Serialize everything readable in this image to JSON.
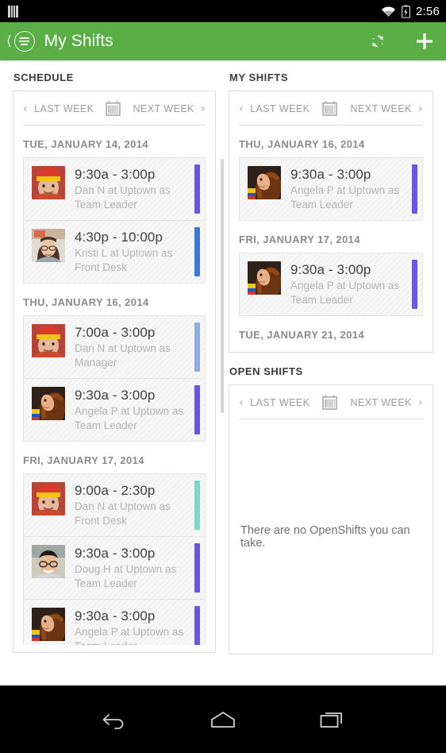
{
  "statusbar": {
    "clock": "2:56",
    "icons": [
      "sim-card-icon",
      "wifi-icon",
      "battery-icon"
    ]
  },
  "appbar": {
    "title": "My Shifts",
    "up_icon": "back-chevron-icon",
    "app_icon": "hamburger-circle-icon",
    "refresh_icon": "refresh-icon",
    "add_icon": "plus-icon",
    "background": "#5BAE46"
  },
  "weeknav": {
    "prev_label": "LAST WEEK",
    "next_label": "NEXT WEEK",
    "calendar_icon": "calendar-icon",
    "prev_icon": "chevron-left-icon",
    "next_icon": "chevron-right-icon"
  },
  "colors": {
    "purple": "#6A57DD",
    "blue": "#3C78D8",
    "light_blue": "#8DAEE0",
    "teal": "#7FD8C4"
  },
  "schedule": {
    "title": "SCHEDULE",
    "days": [
      {
        "date": "TUE, JANUARY 14, 2014",
        "shifts": [
          {
            "time": "9:30a - 3:00p",
            "desc": "Dan N at Uptown as Team Leader",
            "color": "#6A57DD",
            "avatar": "dan-n-avatar"
          },
          {
            "time": "4:30p - 10:00p",
            "desc": "Kristi L at Uptown as Front Desk",
            "color": "#3C78D8",
            "avatar": "kristi-l-avatar"
          }
        ]
      },
      {
        "date": "THU, JANUARY 16, 2014",
        "shifts": [
          {
            "time": "7:00a - 3:00p",
            "desc": "Dan N at Uptown as Manager",
            "color": "#8DAEE0",
            "avatar": "dan-n-avatar"
          },
          {
            "time": "9:30a - 3:00p",
            "desc": "Angela P at Uptown as Team Leader",
            "color": "#6A57DD",
            "avatar": "angela-p-avatar"
          }
        ]
      },
      {
        "date": "FRI, JANUARY 17, 2014",
        "shifts": [
          {
            "time": "9:00a - 2:30p",
            "desc": "Dan N at Uptown as Front Desk",
            "color": "#7FD8C4",
            "avatar": "dan-n-avatar"
          },
          {
            "time": "9:30a - 3:00p",
            "desc": "Doug H at Uptown as Team Leader",
            "color": "#6A57DD",
            "avatar": "doug-h-avatar"
          },
          {
            "time": "9:30a - 3:00p",
            "desc": "Angela P at Uptown as Team Leader",
            "color": "#6A57DD",
            "avatar": "angela-p-avatar"
          }
        ]
      }
    ]
  },
  "myshifts": {
    "title": "MY SHIFTS",
    "days": [
      {
        "date": "THU, JANUARY 16, 2014",
        "shifts": [
          {
            "time": "9:30a - 3:00p",
            "desc": "Angela P at Uptown as Team Leader",
            "color": "#6A57DD",
            "avatar": "angela-p-avatar"
          }
        ]
      },
      {
        "date": "FRI, JANUARY 17, 2014",
        "shifts": [
          {
            "time": "9:30a - 3:00p",
            "desc": "Angela P at Uptown as Team Leader",
            "color": "#6A57DD",
            "avatar": "angela-p-avatar"
          }
        ]
      },
      {
        "date": "TUE, JANUARY 21, 2014",
        "shifts": []
      }
    ]
  },
  "openshifts": {
    "title": "OPEN SHIFTS",
    "empty_message": "There are no OpenShifts you can take."
  },
  "navbar": {
    "back_icon": "back-arrow-icon",
    "home_icon": "home-icon",
    "recents_icon": "recents-icon"
  }
}
